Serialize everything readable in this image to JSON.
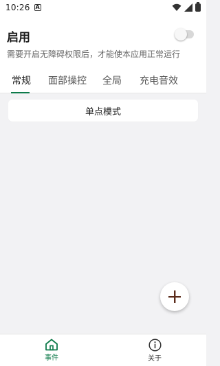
{
  "status_bar": {
    "time": "10:26",
    "notif_icon_letter": "A"
  },
  "header": {
    "title": "启用",
    "subtitle": "需要开启无障碍权限后，才能使本应用正常运行",
    "toggle_on": false
  },
  "tabs": [
    {
      "label": "常规",
      "active": true
    },
    {
      "label": "面部操控",
      "active": false
    },
    {
      "label": "全局",
      "active": false
    },
    {
      "label": "充电音效",
      "active": false
    }
  ],
  "list": {
    "items": [
      {
        "label": "单点模式"
      }
    ]
  },
  "fab": {
    "icon": "plus-icon"
  },
  "bottom_nav": [
    {
      "label": "事件",
      "icon": "home-icon",
      "active": true
    },
    {
      "label": "关于",
      "icon": "info-icon",
      "active": false
    }
  ],
  "colors": {
    "accent": "#0d7a4a",
    "fab_icon": "#5a2a1a",
    "background": "#f2f2f4"
  }
}
